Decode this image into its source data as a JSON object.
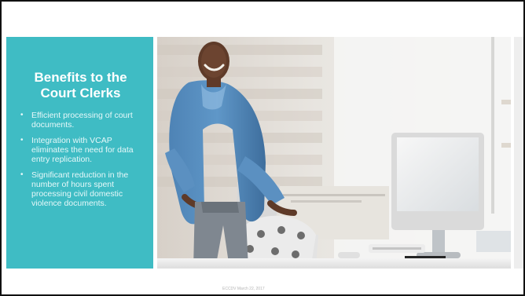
{
  "slide": {
    "title": "Benefits to the Court Clerks",
    "bullets": [
      "Efficient processing of court documents.",
      "Integration with VCAP eliminates the need for data entry replication.",
      "Significant reduction in the number of hours spent processing civil domestic violence documents."
    ],
    "footer": "ECCDV March 22, 2017"
  },
  "photo": {
    "subject": "smiling man in blue shirt standing at desk with desktop computer"
  },
  "colors": {
    "panel": "#3fbcc4",
    "panel_text": "#ffffff",
    "footer_text": "#b5b5b5",
    "border": "#111111"
  }
}
